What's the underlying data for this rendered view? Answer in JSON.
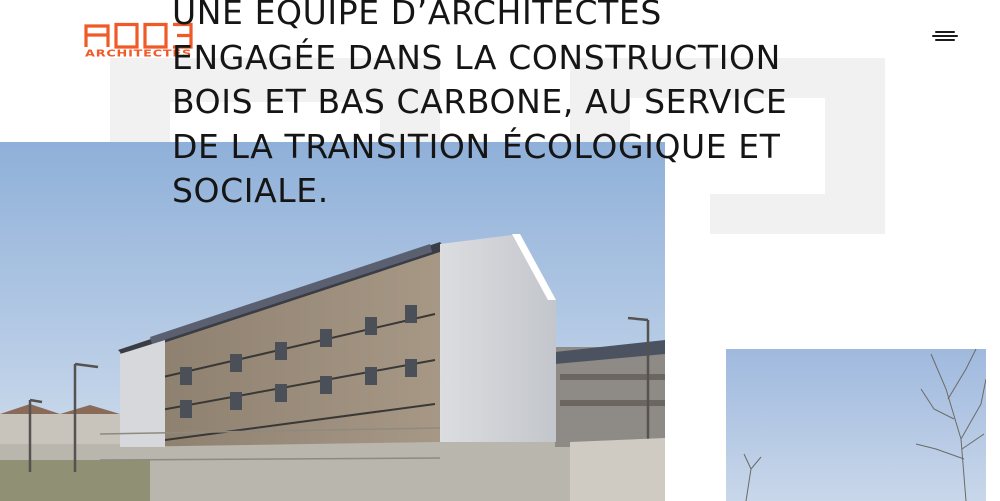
{
  "brand": {
    "logo_main": "A003",
    "logo_sub": "ARCHITECTES",
    "accent_color": "#f05a28"
  },
  "header": {
    "menu_icon": "hamburger-menu-icon"
  },
  "hero": {
    "headline_lines": [
      "UNE ÉQUIPE D’ARCHITECTES",
      "ENGAGÉE DANS LA CONSTRUCTION",
      "BOIS ET BAS CARBONE, AU SERVICE",
      "DE LA TRANSITION ÉCOLOGIQUE ET",
      "SOCIALE."
    ],
    "text_color": "#151515"
  },
  "images": {
    "main_photo": "residential-wood-building-photo",
    "side_photo": "sky-and-tree-photo"
  }
}
